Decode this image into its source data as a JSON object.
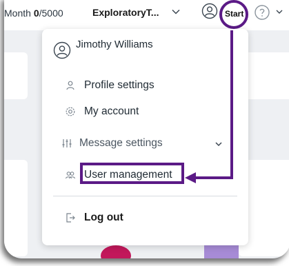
{
  "topbar": {
    "quota_prefix": "Month ",
    "quota_used": "0",
    "quota_total": "/5000",
    "project_name": "ExploratoryT...",
    "icons": {
      "project_dropdown": "chevron-down-icon",
      "user": "user-circle-icon",
      "help": "help-circle-icon",
      "more": "chevron-down-icon"
    }
  },
  "annotation": {
    "start_label": "Start",
    "color": "#5b1a86"
  },
  "menu": {
    "user_name": "Jimothy Williams",
    "items": [
      {
        "label": "Profile settings",
        "icon": "person-icon"
      },
      {
        "label": "My account",
        "icon": "gear-icon"
      },
      {
        "label": "Message settings",
        "icon": "sliders-icon",
        "expandable": true
      },
      {
        "label": "User management",
        "icon": "users-icon",
        "highlighted": true
      },
      {
        "label": "Log out",
        "icon": "logout-icon"
      }
    ]
  }
}
